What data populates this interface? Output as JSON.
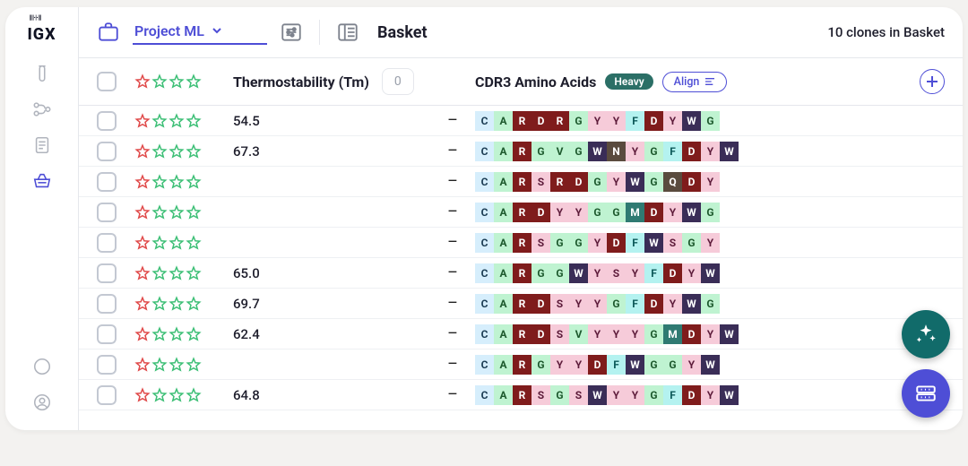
{
  "logo_text": "IGX",
  "project_select": {
    "label": "Project ML"
  },
  "basket_title": "Basket",
  "basket_count_text": "10 clones in Basket",
  "columns": {
    "thermostability_label": "Thermostability (Tm)",
    "cdr3_label": "CDR3 Amino Acids",
    "heavy_badge": "Heavy",
    "align_label": "Align",
    "sort_placeholder": "0"
  },
  "rows": [
    {
      "tm": "54.5",
      "dash": "–",
      "seq": [
        "C",
        "A",
        "R",
        "D",
        "R",
        "G",
        "Y",
        "Y",
        "F",
        "D",
        "Y",
        "W",
        "G"
      ]
    },
    {
      "tm": "67.3",
      "dash": "–",
      "seq": [
        "C",
        "A",
        "R",
        "G",
        "V",
        "G",
        "W",
        "N",
        "Y",
        "G",
        "F",
        "D",
        "Y",
        "W"
      ]
    },
    {
      "tm": "",
      "dash": "–",
      "seq": [
        "C",
        "A",
        "R",
        "S",
        "R",
        "D",
        "G",
        "Y",
        "W",
        "G",
        "Q",
        "D",
        "Y"
      ]
    },
    {
      "tm": "",
      "dash": "–",
      "seq": [
        "C",
        "A",
        "R",
        "D",
        "Y",
        "Y",
        "G",
        "G",
        "M",
        "D",
        "Y",
        "W",
        "G"
      ]
    },
    {
      "tm": "",
      "dash": "–",
      "seq": [
        "C",
        "A",
        "R",
        "S",
        "G",
        "G",
        "Y",
        "D",
        "F",
        "W",
        "S",
        "G",
        "Y"
      ]
    },
    {
      "tm": "65.0",
      "dash": "–",
      "seq": [
        "C",
        "A",
        "R",
        "G",
        "G",
        "W",
        "Y",
        "S",
        "Y",
        "F",
        "D",
        "Y",
        "W"
      ]
    },
    {
      "tm": "69.7",
      "dash": "–",
      "seq": [
        "C",
        "A",
        "R",
        "D",
        "S",
        "Y",
        "Y",
        "G",
        "F",
        "D",
        "Y",
        "W",
        "G"
      ]
    },
    {
      "tm": "62.4",
      "dash": "–",
      "seq": [
        "C",
        "A",
        "R",
        "D",
        "S",
        "V",
        "Y",
        "Y",
        "Y",
        "G",
        "M",
        "D",
        "Y",
        "W"
      ]
    },
    {
      "tm": "",
      "dash": "–",
      "seq": [
        "C",
        "A",
        "R",
        "G",
        "Y",
        "Y",
        "D",
        "F",
        "W",
        "G",
        "G",
        "Y",
        "W"
      ]
    },
    {
      "tm": "64.8",
      "dash": "–",
      "seq": [
        "C",
        "A",
        "R",
        "S",
        "G",
        "S",
        "W",
        "Y",
        "Y",
        "G",
        "F",
        "D",
        "Y",
        "W"
      ]
    }
  ]
}
